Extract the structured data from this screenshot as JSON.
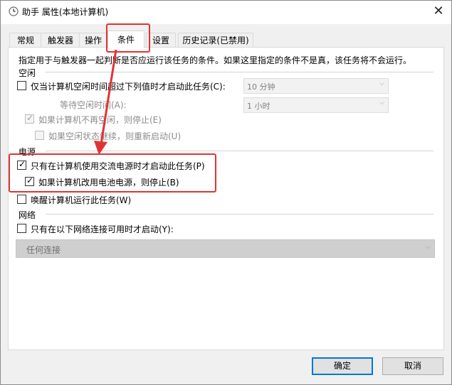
{
  "window": {
    "title": "助手 属性(本地计算机)",
    "close_glyph": "✕"
  },
  "tabs": [
    {
      "label": "常规"
    },
    {
      "label": "触发器"
    },
    {
      "label": "操作"
    },
    {
      "label": "条件"
    },
    {
      "label": "设置"
    },
    {
      "label": "历史记录(已禁用)"
    }
  ],
  "active_tab": "条件",
  "description": "指定用于与触发器一起判断是否应运行该任务的条件。如果这里指定的条件不是真，该任务将不会运行。",
  "idle": {
    "section": "空闲",
    "start_only_if_idle": {
      "label": "仅当计算机空闲时间超过下列值时才启动此任务(C):",
      "checked": false
    },
    "idle_duration": {
      "value": "10 分钟"
    },
    "wait_label": "等待空闲时间(A):",
    "wait_value": {
      "value": "1 小时"
    },
    "stop_if_not_idle": {
      "label": "如果计算机不再空闲，则停止(E)",
      "checked": true,
      "enabled": false
    },
    "restart_if_idle": {
      "label": "如果空闲状态继续，则重新启动(U)",
      "checked": false,
      "enabled": false
    }
  },
  "power": {
    "section": "电源",
    "ac_only": {
      "label": "只有在计算机使用交流电源时才启动此任务(P)",
      "checked": true
    },
    "stop_on_battery": {
      "label": "如果计算机改用电池电源，则停止(B)",
      "checked": true
    },
    "wake": {
      "label": "唤醒计算机运行此任务(W)",
      "checked": false
    }
  },
  "network": {
    "section": "网络",
    "only_if_network": {
      "label": "只有在以下网络连接可用时才启动(Y):",
      "checked": false
    },
    "connection": {
      "value": "任何连接"
    }
  },
  "buttons": {
    "ok": "确定",
    "cancel": "取消"
  },
  "annotation_color": "#e03434",
  "check_glyph": "✓",
  "chevron_glyph": "⌵"
}
